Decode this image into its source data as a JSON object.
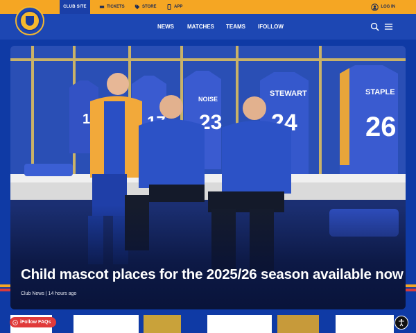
{
  "topbar": {
    "club_site": "CLUB SITE",
    "tickets": "TICKETS",
    "store": "STORE",
    "app": "APP",
    "login": "LOG IN"
  },
  "nav": {
    "items": [
      "NEWS",
      "MATCHES",
      "TEAMS",
      "IFOLLOW"
    ],
    "icons": [
      "search-icon",
      "hamburger-menu-icon"
    ]
  },
  "hero": {
    "headline": "Child mascot places for the 2025/26 season available now",
    "meta": "Club News | 14 hours ago",
    "shirt_numbers": [
      "15",
      "17",
      "23",
      "24",
      "26"
    ],
    "shirt_names": [
      "NOISE",
      "STEWART",
      "STAPLE"
    ]
  },
  "bottom": {
    "faq_label": "iFollow FAQs"
  },
  "colors": {
    "brand_blue": "#1d47b3",
    "brand_amber": "#f5a623",
    "faq_red": "#e03a3a"
  }
}
